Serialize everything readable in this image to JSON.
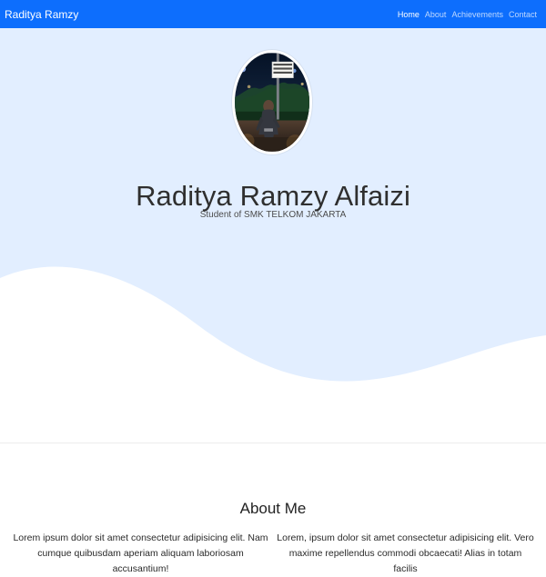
{
  "navbar": {
    "brand": "Raditya Ramzy",
    "links": [
      {
        "label": "Home",
        "active": true
      },
      {
        "label": "About",
        "active": false
      },
      {
        "label": "Achievements",
        "active": false
      },
      {
        "label": "Contact",
        "active": false
      }
    ]
  },
  "hero": {
    "name": "Raditya Ramzy Alfaizi",
    "subtitle": "Student of SMK TELKOM JAKARTA",
    "photo_sign_text": "SAMPAI RAMBU BERIKUT"
  },
  "about": {
    "title": "About Me",
    "paragraph_left": "Lorem ipsum dolor sit amet consectetur adipisicing elit. Nam cumque quibusdam aperiam aliquam laboriosam accusantium!",
    "paragraph_right": "Lorem, ipsum dolor sit amet consectetur adipisicing elit. Vero maxime repellendus commodi obcaecati! Alias in totam facilis"
  },
  "colors": {
    "primary": "#0d6efd",
    "hero_background": "#e2eeff",
    "text_dark": "#2f2f2f",
    "wave": "#ffffff"
  }
}
